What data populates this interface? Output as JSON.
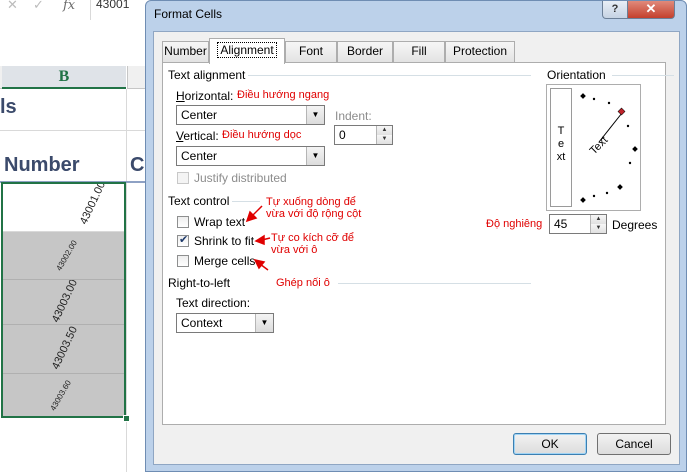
{
  "excel": {
    "formula_bar": {
      "value": "43001"
    },
    "column_b_header": "B",
    "title_fragment": "ls",
    "header_fragment_b": "Number",
    "header_fragment_c": "Co",
    "cells": [
      "43001.00",
      "43002.00",
      "43003.00",
      "43003.50",
      "43003.60"
    ]
  },
  "dialog": {
    "title": "Format Cells",
    "help_label": "?",
    "close_label": "✕",
    "tabs": [
      "Number",
      "Alignment",
      "Font",
      "Border",
      "Fill",
      "Protection"
    ],
    "active_tab": "Alignment",
    "text_alignment": {
      "group_label": "Text alignment",
      "horizontal_label": "Horizontal:",
      "horizontal_value": "Center",
      "vertical_label": "Vertical:",
      "vertical_value": "Center",
      "indent_label": "Indent:",
      "indent_value": "0",
      "justify_distributed_label": "Justify distributed",
      "justify_distributed_checked": false
    },
    "text_control": {
      "group_label": "Text control",
      "wrap_text_label": "Wrap text",
      "wrap_text_checked": false,
      "shrink_to_fit_label": "Shrink to fit",
      "shrink_to_fit_checked": true,
      "merge_cells_label": "Merge cells",
      "merge_cells_checked": false
    },
    "right_to_left": {
      "group_label": "Right-to-left",
      "text_direction_label": "Text direction:",
      "text_direction_value": "Context"
    },
    "orientation": {
      "group_label": "Orientation",
      "vertical_text": "Text",
      "rotated_text": "Text",
      "degrees_value": "45",
      "degrees_label": "Degrees"
    },
    "buttons": {
      "ok": "OK",
      "cancel": "Cancel"
    }
  },
  "annotations": {
    "horizontal": "Điều hướng ngang",
    "vertical": "Điều hướng dọc",
    "wrap_line1": "Tự xuống dòng để",
    "wrap_line2": "vừa với độ rộng cột",
    "shrink_line1": "Tự co kích cỡ để",
    "shrink_line2": "vừa với ô",
    "merge": "Ghép nối ô",
    "degree": "Độ nghiêng",
    "color": "#e00000"
  }
}
